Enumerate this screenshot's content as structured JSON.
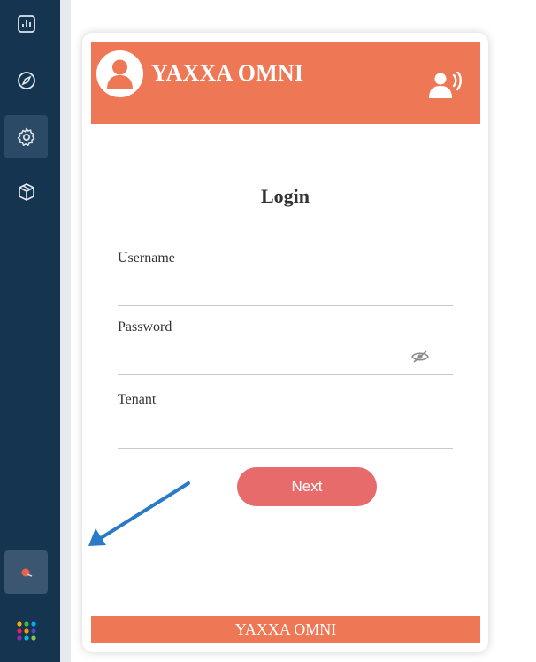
{
  "sidebar": {
    "items": [
      {
        "icon": "chart-icon"
      },
      {
        "icon": "compass-icon"
      },
      {
        "icon": "gear-icon",
        "active": true
      },
      {
        "icon": "box-icon"
      }
    ],
    "bottom_item": {
      "icon": "app-logo-icon"
    },
    "apps_icon": "apps-grid-icon"
  },
  "login_card": {
    "brand_name": "YAXXA OMNI",
    "title": "Login",
    "fields": {
      "username": {
        "label": "Username",
        "value": ""
      },
      "password": {
        "label": "Password",
        "value": ""
      },
      "tenant": {
        "label": "Tenant",
        "value": ""
      }
    },
    "next_label": "Next",
    "footer_text": "YAXXA OMNI"
  },
  "colors": {
    "sidebar": "#15344f",
    "brand": "#ee7755",
    "button": "#e76b6b",
    "annotation_arrow": "#2a7ac8"
  }
}
